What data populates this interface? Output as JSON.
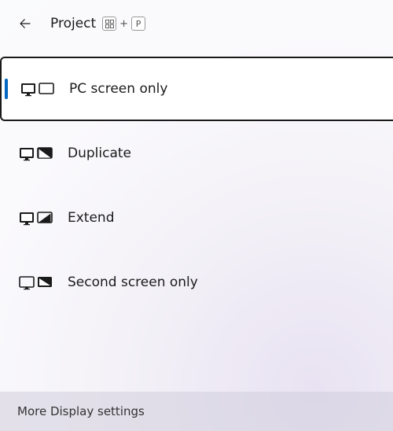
{
  "header": {
    "title": "Project",
    "shortcut_plus": "+",
    "shortcut_key": "P"
  },
  "options": [
    {
      "label": "PC screen only",
      "icon": "pc-screen-only",
      "selected": true
    },
    {
      "label": "Duplicate",
      "icon": "duplicate",
      "selected": false
    },
    {
      "label": "Extend",
      "icon": "extend",
      "selected": false
    },
    {
      "label": "Second screen only",
      "icon": "second-screen-only",
      "selected": false
    }
  ],
  "footer": {
    "more_label": "More Display settings"
  }
}
